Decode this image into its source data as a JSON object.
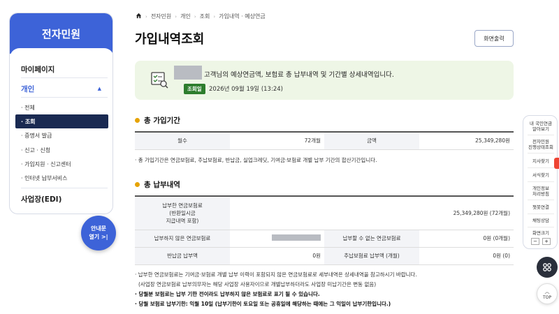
{
  "sidebar": {
    "title": "전자민원",
    "items": [
      {
        "label": "마이페이지"
      },
      {
        "label": "개인"
      },
      {
        "label": "사업장(EDI)"
      }
    ],
    "sub_items": [
      {
        "label": "· 전체"
      },
      {
        "label": "· 조회"
      },
      {
        "label": "· 증명서 발급"
      },
      {
        "label": "· 신고 · 신청"
      },
      {
        "label": "· 가입지원 · 신고센터"
      },
      {
        "label": "· 인터넷 납부서비스"
      }
    ]
  },
  "guide_button": {
    "line1": "안내문",
    "line2": "열기 >|"
  },
  "breadcrumb": [
    "전자민원",
    "개인",
    "조회",
    "가입내역 · 예상연금"
  ],
  "page_title": "가입내역조회",
  "print_button": "화면출력",
  "notice": {
    "text": "고객님의 예상연금액, 보험료 총 납부내역 및 기간별 상세내역입니다.",
    "date_label": "조회일",
    "date_value": "2026년 09월 19일 (13:24)"
  },
  "section1": {
    "title": "총 가입기간",
    "headers": [
      "월수",
      "금액"
    ],
    "months": "72개월",
    "amount": "25,349,280원",
    "note": "· 총 가입기간은 연금보험료, 추납보험료, 반납금, 실업크레딧, 기여금·보험료 개별 납부 기간의 합산기간입니다."
  },
  "section2": {
    "title": "총 납부내역",
    "row1_header_l1": "납부한 연금보험료",
    "row1_header_l2": "(반환일시금",
    "row1_header_l3": "지급내역 포함)",
    "row1_value": "25,349,280원 (72개월)",
    "row2_header_a": "납부하지 않은 연금보험료",
    "row2_header_b": "납부할 수 없는 연금보험료",
    "row2_value_b": "0원 (0개월)",
    "row3_header_a": "반납금 납부액",
    "row3_value_a": "0원",
    "row3_header_b": "추납보험료 납부액 (개월)",
    "row3_value_b": "0원 (0)"
  },
  "notes": [
    "· 납부한 연금보험료는 기여금·보험료 개별 납부 이력이 포함되지 않은 연금보험료로 세부내역은 상세내역을 참고하시기 바랍니다.",
    "  (사업장 연금보험료 납부의무자는 해당 사업장 사용자이므로 개별납부하더라도 사업장 미납기간은 변동 없음)",
    "· 당월분 보험료는 납부 기한 전이라도 납부하지 않은 보험료로 표기 될 수 있습니다.",
    "· 당월 보험료 납부기한: 익월 10일 (납부기한이 토요일 또는 공휴일에 해당하는 때에는 그 익일이 납부기한입니다.)"
  ],
  "quick_menu": [
    {
      "l1": "내 국민연금",
      "l2": "알아보기"
    },
    {
      "l1": "전자민원",
      "l2": "진행상태조회"
    },
    {
      "l1": "지사찾기",
      "l2": ""
    },
    {
      "l1": "서식찾기",
      "l2": ""
    },
    {
      "l1": "개인정보",
      "l2": "처리방침"
    },
    {
      "l1": "챗봇연결",
      "l2": ""
    },
    {
      "l1": "채팅상담",
      "l2": ""
    },
    {
      "l1": "화면크기",
      "l2": ""
    }
  ],
  "zoom_minus": "−",
  "zoom_plus": "+",
  "top_button": "TOP",
  "colors": {
    "brand": "#3d63d8",
    "active": "#1a2a52",
    "notice_bg": "#eef6e6",
    "badge": "#2d7d2d",
    "dot": "#e6a300"
  }
}
